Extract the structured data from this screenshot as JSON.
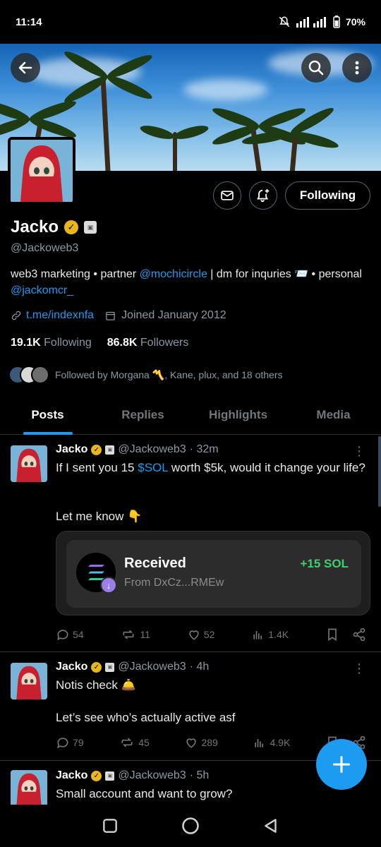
{
  "status": {
    "time": "11:14",
    "battery": "70%"
  },
  "profile": {
    "name": "Jacko",
    "handle": "@Jackoweb3",
    "bio_part1": "web3 marketing • partner ",
    "bio_link1": "@mochicircle",
    "bio_part2": " | dm for inquries 📨 • personal ",
    "bio_link2": "@jackomcr_",
    "website": "t.me/indexnfa",
    "joined": "Joined January 2012",
    "following_count": "19.1K",
    "following_label": "Following",
    "followers_count": "86.8K",
    "followers_label": "Followers",
    "followed_by": "Followed by Morgana 〽️, Kane, plux, and 18 others",
    "follow_button": "Following"
  },
  "tabs": [
    {
      "label": "Posts"
    },
    {
      "label": "Replies"
    },
    {
      "label": "Highlights"
    },
    {
      "label": "Media"
    }
  ],
  "posts": [
    {
      "name": "Jacko",
      "handle": "@Jackoweb3",
      "time": "· 32m",
      "text_a": "If I sent you 15 ",
      "text_link": "$SOL",
      "text_b": " worth $5k, would it change your life?",
      "text_c": "Let me know 👇",
      "replies": "54",
      "reposts": "11",
      "likes": "52",
      "views": "1.4K"
    },
    {
      "name": "Jacko",
      "handle": "@Jackoweb3",
      "time": "· 4h",
      "text_a": "Notis check 🛎️",
      "text_c": "Let’s see who’s actually active asf",
      "replies": "79",
      "reposts": "45",
      "likes": "289",
      "views": "4.9K"
    },
    {
      "name": "Jacko",
      "handle": "@Jackoweb3",
      "time": "· 5h",
      "text_a": "Small account and want to grow?"
    }
  ],
  "card": {
    "title": "Received",
    "subtitle": "From DxCz...RMEw",
    "amount": "+15 SOL"
  },
  "colors": {
    "accent": "#1d9bf0",
    "verified": "#e9b71a",
    "success": "#3ecf6e"
  }
}
